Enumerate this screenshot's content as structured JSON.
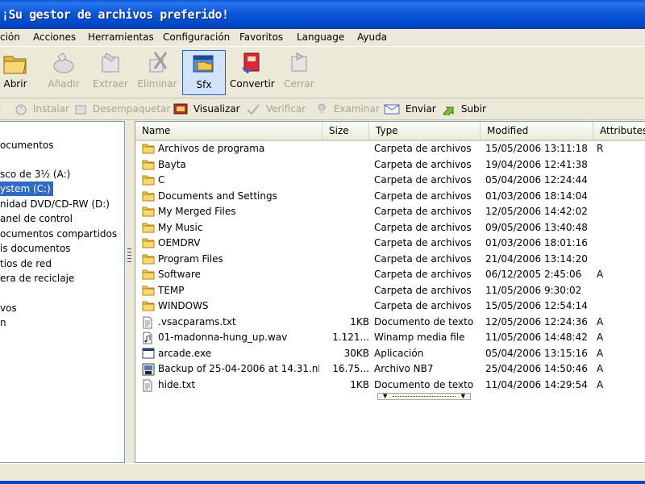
{
  "window": {
    "title": "¡Su gestor de archivos preferido!"
  },
  "menu": [
    "ción",
    "Acciones",
    "Herramientas",
    "Configuración",
    "Favoritos",
    "Language",
    "Ayuda"
  ],
  "toolbar": {
    "abrir": "Abrir",
    "anadir": "Añadir",
    "extraer": "Extraer",
    "eliminar": "Eliminar",
    "sfx": "Sfx",
    "convertir": "Convertir",
    "cerrar": "Cerrar"
  },
  "toolbar2": {
    "instalar": "Instalar",
    "desempaquetar": "Desempaquetar",
    "visualizar": "Visualizar",
    "verificar": "Verificar",
    "examinar": "Examinar",
    "enviar": "Enviar",
    "subir": "Subir"
  },
  "tree": [
    "ocumentos",
    "sco de 3½ (A:)",
    "ystem (C:)",
    "nidad DVD/CD-RW (D:)",
    "anel de control",
    "ocumentos compartidos",
    "is documentos",
    "tios de red",
    "era de reciclaje",
    "vos",
    "n"
  ],
  "columns": {
    "name": "Name",
    "size": "Size",
    "type": "Type",
    "modified": "Modified",
    "attributes": "Attributes"
  },
  "files": [
    {
      "name": "Archivos de programa",
      "size": "",
      "type": "Carpeta de archivos",
      "modified": "15/05/2006 13:11:18",
      "attr": "R",
      "icon": "folder-icon"
    },
    {
      "name": "Bayta",
      "size": "",
      "type": "Carpeta de archivos",
      "modified": "19/04/2006 12:41:38",
      "attr": "",
      "icon": "folder-icon"
    },
    {
      "name": "C",
      "size": "",
      "type": "Carpeta de archivos",
      "modified": "05/04/2006 12:24:44",
      "attr": "",
      "icon": "folder-icon"
    },
    {
      "name": "Documents and Settings",
      "size": "",
      "type": "Carpeta de archivos",
      "modified": "01/03/2006 18:14:04",
      "attr": "",
      "icon": "folder-icon"
    },
    {
      "name": "My Merged Files",
      "size": "",
      "type": "Carpeta de archivos",
      "modified": "12/05/2006 14:42:02",
      "attr": "",
      "icon": "folder-icon"
    },
    {
      "name": "My Music",
      "size": "",
      "type": "Carpeta de archivos",
      "modified": "09/05/2006 13:40:48",
      "attr": "",
      "icon": "folder-icon"
    },
    {
      "name": "OEMDRV",
      "size": "",
      "type": "Carpeta de archivos",
      "modified": "01/03/2006 18:01:16",
      "attr": "",
      "icon": "folder-icon"
    },
    {
      "name": "Program Files",
      "size": "",
      "type": "Carpeta de archivos",
      "modified": "21/04/2006 13:14:20",
      "attr": "",
      "icon": "folder-icon"
    },
    {
      "name": "Software",
      "size": "",
      "type": "Carpeta de archivos",
      "modified": "06/12/2005 2:45:06",
      "attr": "A",
      "icon": "folder-icon"
    },
    {
      "name": "TEMP",
      "size": "",
      "type": "Carpeta de archivos",
      "modified": "11/05/2006 9:30:02",
      "attr": "",
      "icon": "folder-icon"
    },
    {
      "name": "WINDOWS",
      "size": "",
      "type": "Carpeta de archivos",
      "modified": "15/05/2006 12:54:14",
      "attr": "",
      "icon": "folder-icon"
    },
    {
      "name": ".vsacparams.txt",
      "size": "1KB",
      "type": "Documento de texto",
      "modified": "12/05/2006 12:24:36",
      "attr": "A",
      "icon": "text-file-icon"
    },
    {
      "name": "01-madonna-hung_up.wav",
      "size": "1.121...",
      "type": "Winamp media file",
      "modified": "11/05/2006 14:48:42",
      "attr": "A",
      "icon": "audio-file-icon"
    },
    {
      "name": "arcade.exe",
      "size": "30KB",
      "type": "Aplicación",
      "modified": "05/04/2006 13:15:16",
      "attr": "A",
      "icon": "exe-file-icon"
    },
    {
      "name": "Backup of 25-04-2006 at 14.31.nb7",
      "size": "16.75...",
      "type": "Archivo NB7",
      "modified": "25/04/2006 14:50:46",
      "attr": "A",
      "icon": "nb7-file-icon"
    },
    {
      "name": "hide.txt",
      "size": "1KB",
      "type": "Documento de texto",
      "modified": "11/04/2006 14:29:54",
      "attr": "A",
      "icon": "text-file-icon"
    }
  ],
  "colors": {
    "titlebar": "#0a56d8",
    "selection": "#316ac5",
    "folder": "#f3c74e"
  }
}
